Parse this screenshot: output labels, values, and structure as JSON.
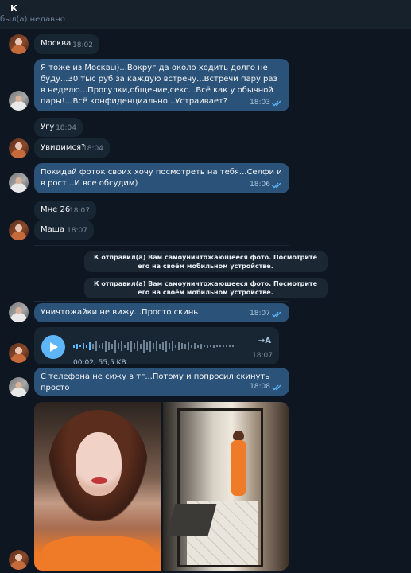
{
  "header": {
    "name": "К",
    "status": "был(а) недавно"
  },
  "messages": [
    {
      "text": "Москва",
      "time": "18:02"
    },
    {
      "text": "Я тоже из Москвы)...Вокруг да около ходить долго не буду...30 тыс руб за каждую встречу...Встречи пару раз в неделю...Прогулки,общение,секс...Всё как у обычной пары!...Всё конфиденциально...Устраивает?",
      "time": "18:03"
    },
    {
      "text": "Угу",
      "time": "18:04"
    },
    {
      "text": "Увидимся?",
      "time": "18:04"
    },
    {
      "text": "Покидай фоток своих хочу посмотреть на тебя...Селфи и в рост...И все обсудим)",
      "time": "18:06"
    },
    {
      "text": "Мне 26",
      "time": "18:07"
    },
    {
      "text": "Маша",
      "time": "18:07"
    },
    {
      "text": "Уничтожайки не вижу...Просто скинь",
      "time": "18:07"
    },
    {
      "text": "С телефона не сижу в тг...Потому и попросил скинуть просто",
      "time": "18:08"
    }
  ],
  "service": [
    "К отправил(а) Вам самоуничтожающееся фото. Посмотрите его на своём мобильном устройстве.",
    "К отправил(а) Вам самоуничтожающееся фото. Посмотрите его на своём мобильном устройстве."
  ],
  "voice": {
    "meta": "00:02, 55,5 KB",
    "time": "18:07",
    "to_text": "→A"
  },
  "colors": {
    "bg": "#0e1621",
    "incoming": "#182533",
    "outgoing": "#2b5278",
    "accent": "#5eb5f7"
  },
  "icons": [
    "avatar",
    "double-check-icon",
    "play-icon",
    "waveform",
    "transcribe-icon"
  ]
}
